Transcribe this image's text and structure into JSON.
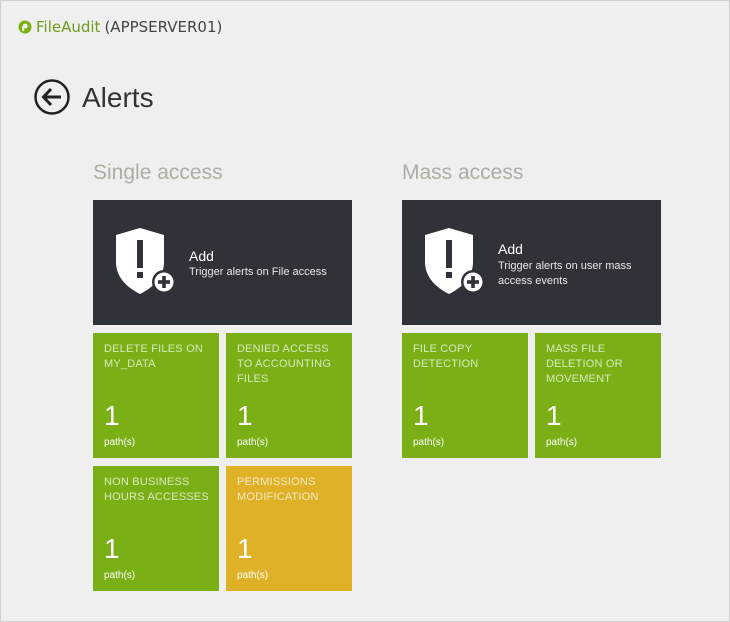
{
  "app": {
    "name": "FileAudit",
    "server": "(APPSERVER01)",
    "brand_color": "#6d9b1d"
  },
  "page": {
    "title": "Alerts"
  },
  "sections": {
    "single": {
      "title": "Single access",
      "add_tile": {
        "label": "Add",
        "description": "Trigger alerts on File access"
      },
      "tiles": [
        {
          "name": "DELETE FILES ON MY_DATA",
          "count": "1",
          "unit": "path(s)",
          "color": "#7aaf16"
        },
        {
          "name": "DENIED ACCESS TO ACCOUNTING FILES",
          "count": "1",
          "unit": "path(s)",
          "color": "#7aaf16"
        },
        {
          "name": "NON BUSINESS HOURS ACCESSES",
          "count": "1",
          "unit": "path(s)",
          "color": "#7aaf16"
        },
        {
          "name": "PERMISSIONS MODIFICATION",
          "count": "1",
          "unit": "path(s)",
          "color": "#dfb127"
        }
      ]
    },
    "mass": {
      "title": "Mass access",
      "add_tile": {
        "label": "Add",
        "description": "Trigger alerts on user mass access events"
      },
      "tiles": [
        {
          "name": "FILE COPY DETECTION",
          "count": "1",
          "unit": "path(s)",
          "color": "#7aaf16"
        },
        {
          "name": "MASS FILE DELETION OR MOVEMENT",
          "count": "1",
          "unit": "path(s)",
          "color": "#7aaf16"
        }
      ]
    }
  },
  "icons": {
    "app_logo": "fileaudit-logo-icon",
    "back": "back-arrow-icon",
    "alert_shield": "shield-alert-add-icon"
  }
}
